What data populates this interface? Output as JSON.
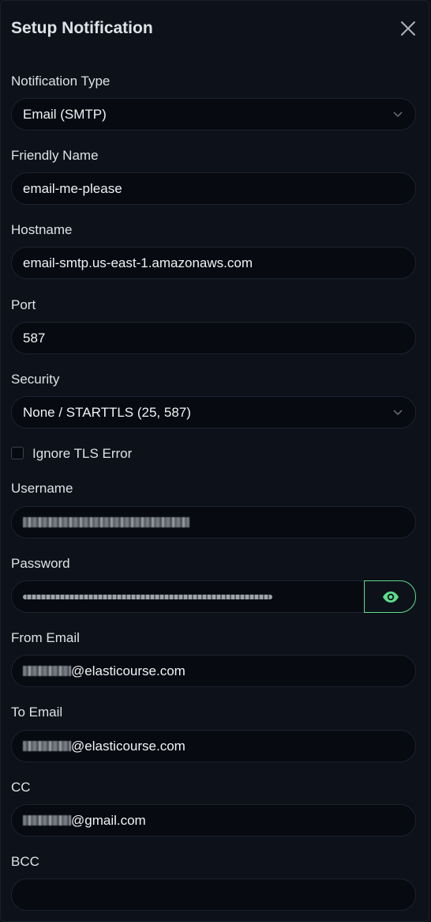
{
  "dialog": {
    "title": "Setup Notification",
    "close_icon": "close-icon"
  },
  "form": {
    "notification_type": {
      "label": "Notification Type",
      "value": "Email (SMTP)"
    },
    "friendly_name": {
      "label": "Friendly Name",
      "value": "email-me-please"
    },
    "hostname": {
      "label": "Hostname",
      "value": "email-smtp.us-east-1.amazonaws.com"
    },
    "port": {
      "label": "Port",
      "value": "587"
    },
    "security": {
      "label": "Security",
      "value": "None / STARTTLS (25, 587)"
    },
    "ignore_tls": {
      "label": "Ignore TLS Error",
      "checked": false
    },
    "username": {
      "label": "Username"
    },
    "password": {
      "label": "Password",
      "toggle_icon": "eye-icon"
    },
    "from_email": {
      "label": "From Email",
      "value_suffix": "@elasticourse.com"
    },
    "to_email": {
      "label": "To Email",
      "value_suffix": "@elasticourse.com"
    },
    "cc": {
      "label": "CC",
      "value_suffix": "@gmail.com"
    },
    "bcc": {
      "label": "BCC",
      "value": ""
    }
  },
  "colors": {
    "background": "#0d1119",
    "input_background": "#070a10",
    "accent_green": "#5cdd8b",
    "text": "#dee2e6"
  }
}
